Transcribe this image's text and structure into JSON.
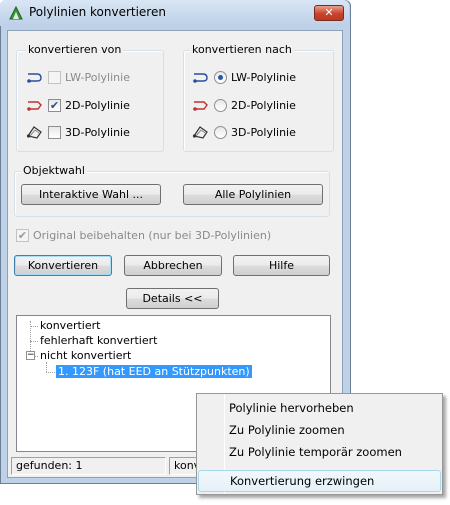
{
  "window": {
    "title": "Polylinien konvertieren",
    "close_label": "✕"
  },
  "konvertieren_von": {
    "label": "konvertieren von",
    "options": [
      {
        "label": "LW-Polylinie",
        "checked": false,
        "enabled": false,
        "icon": "lwpolyline-icon"
      },
      {
        "label": "2D-Polylinie",
        "checked": true,
        "enabled": true,
        "icon": "2d-polyline-icon"
      },
      {
        "label": "3D-Polylinie",
        "checked": false,
        "enabled": true,
        "icon": "3d-polyline-icon"
      }
    ]
  },
  "konvertieren_nach": {
    "label": "konvertieren nach",
    "options": [
      {
        "label": "LW-Polylinie",
        "selected": true,
        "icon": "lwpolyline-icon"
      },
      {
        "label": "2D-Polylinie",
        "selected": false,
        "icon": "2d-polyline-icon"
      },
      {
        "label": "3D-Polylinie",
        "selected": false,
        "icon": "3d-polyline-icon"
      }
    ]
  },
  "objektwahl": {
    "label": "Objektwahl",
    "interactive_label": "Interaktive Wahl ...",
    "all_label": "Alle Polylinien"
  },
  "original": {
    "label": "Original beibehalten (nur bei 3D-Polylinien)",
    "checked": true,
    "enabled": false
  },
  "buttons": {
    "convert": "Konvertieren",
    "cancel": "Abbrechen",
    "help": "Hilfe",
    "details": "Details <<"
  },
  "tree": {
    "items": [
      {
        "label": "konvertiert"
      },
      {
        "label": "fehlerhaft konvertiert"
      },
      {
        "label": "nicht konvertiert",
        "expanded": true
      },
      {
        "label": "1. 123F (hat EED an Stützpunkten)",
        "selected": true
      }
    ]
  },
  "status": {
    "found": "gefunden: 1",
    "converted": "konv"
  },
  "context_menu": {
    "items": [
      {
        "label": "Polylinie hervorheben"
      },
      {
        "label": "Zu Polylinie zoomen"
      },
      {
        "label": "Zu Polylinie temporär zoomen"
      },
      {
        "label": "Konvertierung erzwingen",
        "hot": true
      }
    ]
  },
  "colors": {
    "window_frame": "#bfd1e6",
    "client": "#f0f0f0",
    "selection": "#3399ff",
    "close_button": "#c8442c"
  }
}
